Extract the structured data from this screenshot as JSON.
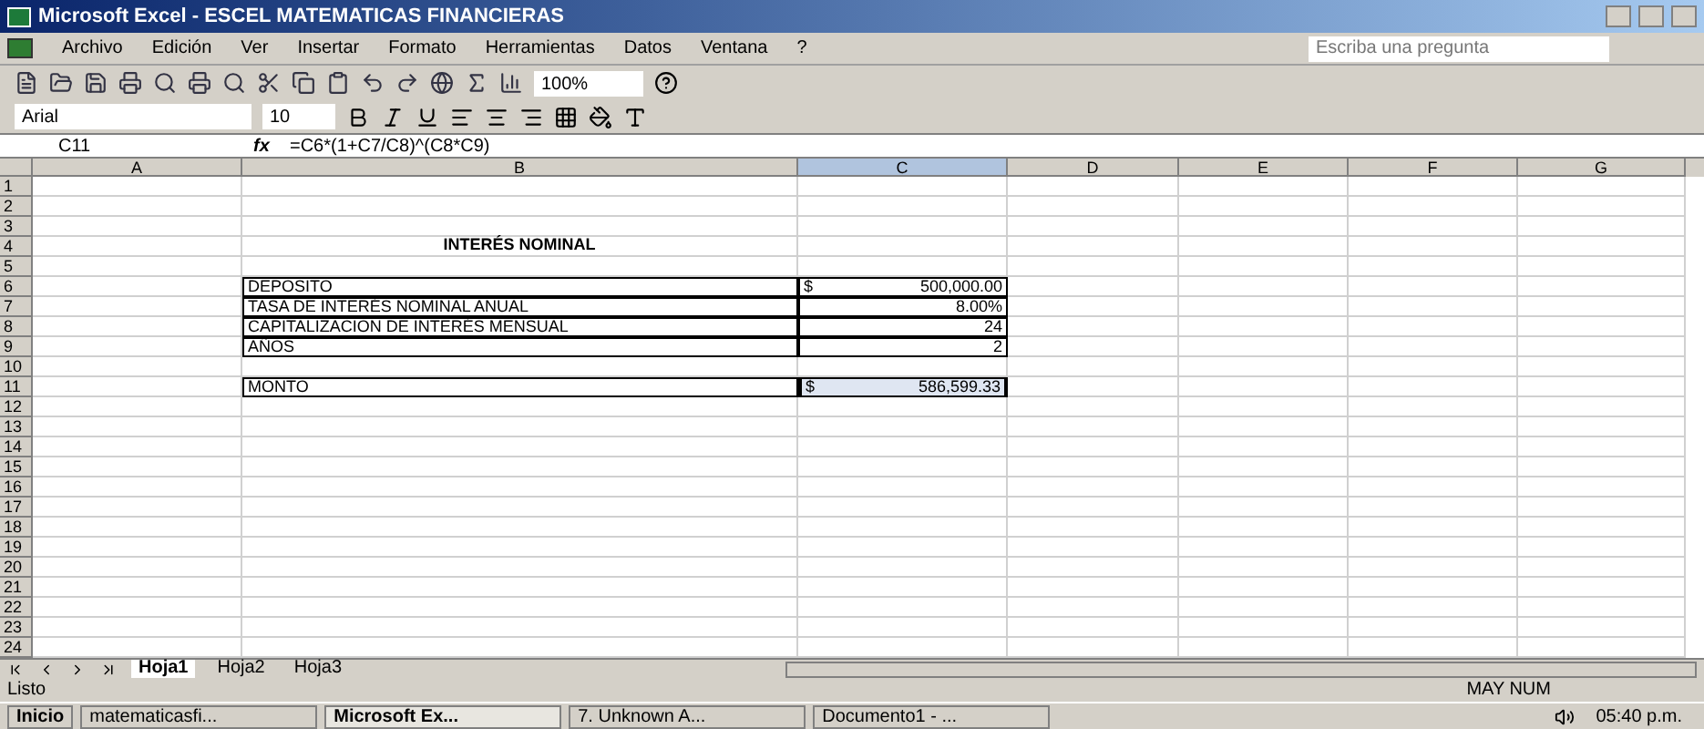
{
  "window": {
    "title": "Microsoft Excel - ESCEL MATEMATICAS FINANCIERAS"
  },
  "menu": [
    "Archivo",
    "Edición",
    "Ver",
    "Insertar",
    "Formato",
    "Herramientas",
    "Datos",
    "Ventana",
    "?"
  ],
  "help_search": {
    "placeholder": "Escriba una pregunta"
  },
  "toolbar": {
    "zoom": "100%"
  },
  "format_bar": {
    "font": "Arial",
    "size": "10"
  },
  "formula_bar": {
    "name_box": "C11",
    "fx": "fx",
    "formula": "=C6*(1+C7/C8)^(C8*C9)"
  },
  "columns": [
    {
      "label": "A",
      "selected": false
    },
    {
      "label": "B",
      "selected": false
    },
    {
      "label": "C",
      "selected": true
    },
    {
      "label": "D",
      "selected": false
    },
    {
      "label": "E",
      "selected": false
    },
    {
      "label": "F",
      "selected": false
    },
    {
      "label": "G",
      "selected": false
    }
  ],
  "rows": [
    {
      "number": "1",
      "kind": "blank"
    },
    {
      "number": "2",
      "kind": "blank"
    },
    {
      "number": "3",
      "kind": "blank"
    },
    {
      "number": "4",
      "kind": "title",
      "label": "INTERÉS NOMINAL"
    },
    {
      "number": "5",
      "kind": "blank"
    },
    {
      "number": "6",
      "kind": "entry",
      "label": "DEPOSITO",
      "currency": "$",
      "value": "500,000.00",
      "selected": false
    },
    {
      "number": "7",
      "kind": "entry",
      "label": "TASA DE INTERÉS NOMINAL ANUAL",
      "value": "8.00%",
      "selected": false
    },
    {
      "number": "8",
      "kind": "entry",
      "label": "CAPITALIZACION DE INTERÉS MENSUAL",
      "value": "24",
      "selected": false
    },
    {
      "number": "9",
      "kind": "entry",
      "label": "AÑOS",
      "value": "2",
      "selected": false
    },
    {
      "number": "10",
      "kind": "blank"
    },
    {
      "number": "11",
      "kind": "entry",
      "label": "MONTO",
      "currency": "$",
      "value": "586,599.33",
      "selected": true
    },
    {
      "number": "12",
      "kind": "blank"
    },
    {
      "number": "13",
      "kind": "blank"
    },
    {
      "number": "14",
      "kind": "blank"
    },
    {
      "number": "15",
      "kind": "blank"
    },
    {
      "number": "16",
      "kind": "blank"
    },
    {
      "number": "17",
      "kind": "blank"
    },
    {
      "number": "18",
      "kind": "blank"
    },
    {
      "number": "19",
      "kind": "blank"
    },
    {
      "number": "20",
      "kind": "blank"
    },
    {
      "number": "21",
      "kind": "blank"
    },
    {
      "number": "22",
      "kind": "blank"
    },
    {
      "number": "23",
      "kind": "blank"
    },
    {
      "number": "24",
      "kind": "blank"
    }
  ],
  "sheet_tabs": [
    {
      "label": "Hoja1",
      "selected": true
    },
    {
      "label": "Hoja2",
      "selected": false
    },
    {
      "label": "Hoja3",
      "selected": false
    }
  ],
  "status_bar": {
    "text": "Listo",
    "indicators": "MAY NUM"
  },
  "taskbar": {
    "start": "Inicio",
    "tasks": [
      {
        "label": "matematicasfi...",
        "selected": false
      },
      {
        "label": "Microsoft Ex...",
        "selected": true
      },
      {
        "label": "7. Unknown A...",
        "selected": false
      },
      {
        "label": "Documento1 - ...",
        "selected": false
      }
    ],
    "clock": "05:40 p.m."
  }
}
